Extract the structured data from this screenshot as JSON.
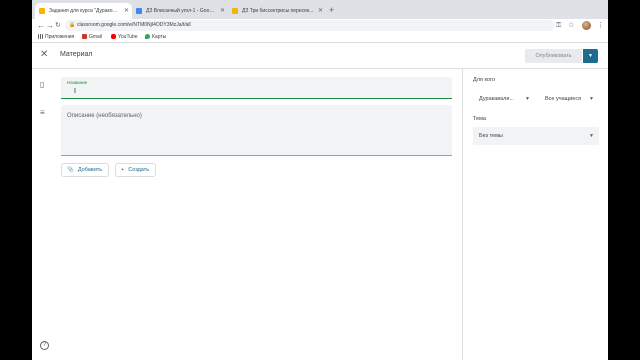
{
  "browser": {
    "tabs": [
      {
        "title": "Задания для курса \"Дуракова...",
        "favicon_color": "#f6b400",
        "active": true
      },
      {
        "title": "ДЗ Вписанный угол-1 - Google...",
        "favicon_color": "#4285f4",
        "active": false
      },
      {
        "title": "ДЗ Три биссектрисы пересек...",
        "favicon_color": "#f6b400",
        "active": false
      }
    ],
    "new_tab_symbol": "+",
    "url": "classroom.google.com/w/NTM0NjI4ODY3MzJa/t/all",
    "bookmarks": [
      {
        "label": "Приложения",
        "icon": "apps-icon",
        "color": "#5f6368"
      },
      {
        "label": "Gmail",
        "icon": "gmail-icon",
        "color": "#d93025"
      },
      {
        "label": "YouTube",
        "icon": "youtube-icon",
        "color": "#ff0000"
      },
      {
        "label": "Карты",
        "icon": "maps-icon",
        "color": "#34a853"
      }
    ]
  },
  "header": {
    "title": "Материал",
    "publish_label": "Опубликовать",
    "accent_color": "#1e6b8f"
  },
  "form": {
    "title_label": "Название",
    "title_value": "",
    "description_placeholder": "Описание (необязательно)",
    "add_label": "Добавить",
    "create_label": "Создать"
  },
  "sidebar": {
    "for_whom_label": "Для кого",
    "class_select": "Дуракавали...",
    "students_select": "Все учащиеся",
    "topic_label": "Тема",
    "topic_select": "Без темы"
  }
}
